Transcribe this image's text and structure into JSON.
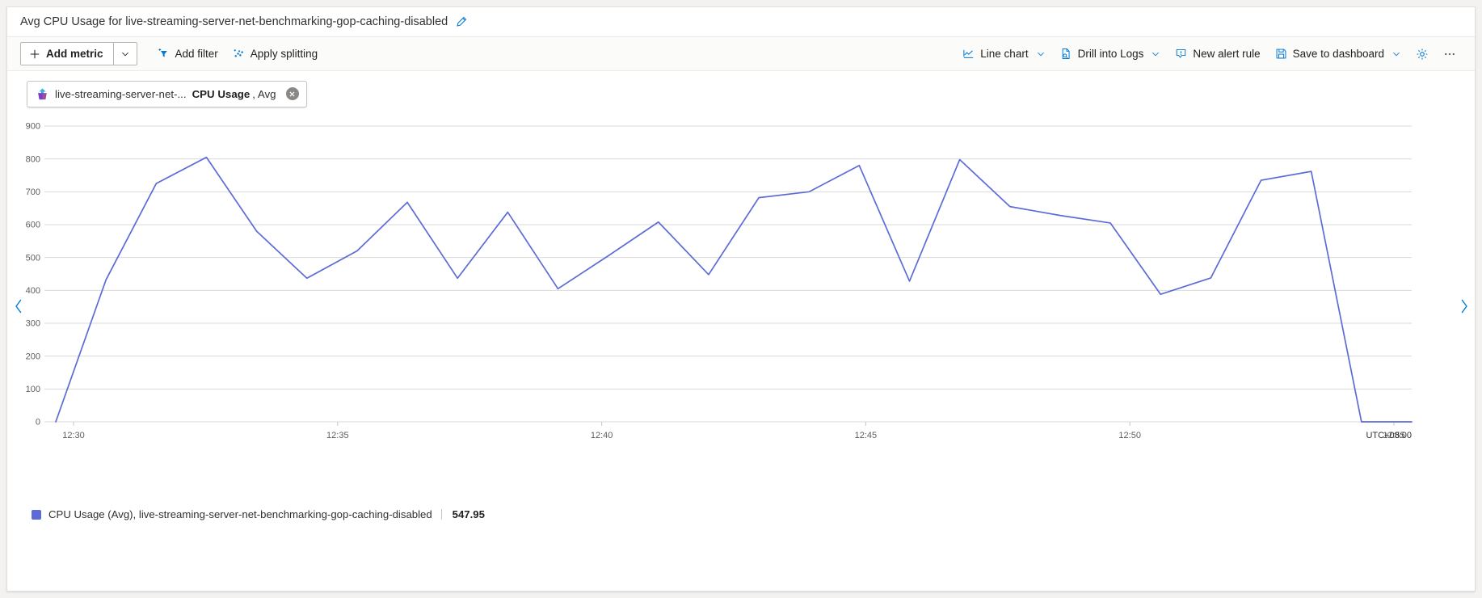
{
  "header": {
    "title": "Avg CPU Usage for live-streaming-server-net-benchmarking-gop-caching-disabled",
    "edit_icon": "pencil-icon"
  },
  "toolbar": {
    "add_metric_label": "Add metric",
    "add_metric_icon": "plus-icon",
    "add_metric_chevron_icon": "chevron-down-icon",
    "add_filter_label": "Add filter",
    "add_filter_icon": "filter-add-icon",
    "apply_splitting_label": "Apply splitting",
    "apply_splitting_icon": "splitting-scatter-icon",
    "line_chart_label": "Line chart",
    "line_chart_icon": "line-chart-icon",
    "drill_into_logs_label": "Drill into Logs",
    "drill_into_logs_icon": "logs-query-icon",
    "new_alert_rule_label": "New alert rule",
    "new_alert_rule_icon": "alert-bell-icon",
    "save_to_dashboard_label": "Save to dashboard",
    "save_to_dashboard_icon": "save-disk-icon",
    "settings_icon": "gear-icon",
    "more_icon": "ellipsis-icon",
    "chevron_icon": "chevron-down-icon"
  },
  "metric_chip": {
    "resource_icon": "azure-resource-icon",
    "resource_name": "live-streaming-server-net-...",
    "metric_name": "CPU Usage",
    "aggregation": ", Avg",
    "close_icon": "close-circle-icon"
  },
  "navigation": {
    "prev_icon": "chevron-left-icon",
    "next_icon": "chevron-right-icon"
  },
  "legend": {
    "swatch_color": "#5c6cd6",
    "label": "CPU Usage (Avg), live-streaming-server-net-benchmarking-gop-caching-disabled",
    "value": "547.95"
  },
  "colors": {
    "series": "#5c6cd6",
    "accent": "#0078d4",
    "gridline": "#d9d9d9",
    "axis_text": "#605e5c"
  },
  "chart_data": {
    "type": "line",
    "title": "Avg CPU Usage for live-streaming-server-net-benchmarking-gop-caching-disabled",
    "xlabel": "",
    "ylabel": "",
    "timezone": "UTC+08:00",
    "grid": true,
    "legend_position": "bottom-left",
    "ylim": [
      0,
      900
    ],
    "yticks": [
      0,
      100,
      200,
      300,
      400,
      500,
      600,
      700,
      800,
      900
    ],
    "xticks": [
      "12:30",
      "12:35",
      "12:40",
      "12:45",
      "12:50",
      "12:55"
    ],
    "xlim": [
      "12:29",
      "12:57"
    ],
    "series": [
      {
        "name": "CPU Usage (Avg), live-streaming-server-net-benchmarking-gop-caching-disabled",
        "color": "#5c6cd6",
        "current_value": 547.95,
        "x": [
          "12:29",
          "12:30",
          "12:31",
          "12:32",
          "12:33",
          "12:34",
          "12:35",
          "12:36",
          "12:37",
          "12:38",
          "12:39",
          "12:40",
          "12:41",
          "12:42",
          "12:43",
          "12:44",
          "12:45",
          "12:46",
          "12:47",
          "12:48",
          "12:49",
          "12:50",
          "12:51",
          "12:52",
          "12:53",
          "12:54",
          "12:55",
          "12:56"
        ],
        "values": [
          0,
          432,
          725,
          805,
          580,
          437,
          520,
          668,
          437,
          638,
          405,
          505,
          608,
          448,
          682,
          700,
          780,
          428,
          798,
          655,
          628,
          605,
          388,
          438,
          735,
          762,
          0,
          0
        ]
      }
    ]
  }
}
